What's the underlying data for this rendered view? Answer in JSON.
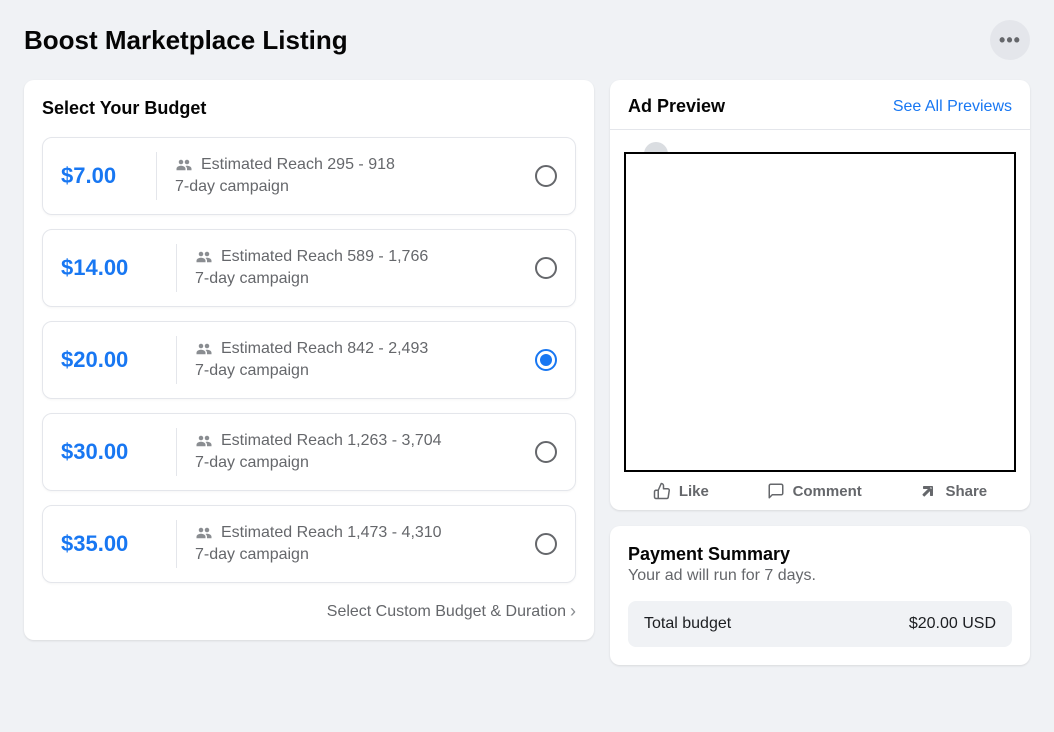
{
  "header": {
    "title": "Boost Marketplace Listing"
  },
  "budget": {
    "title": "Select Your Budget",
    "options": [
      {
        "price": "$7.00",
        "reach": "Estimated Reach 295 - 918",
        "duration": "7-day campaign",
        "selected": false
      },
      {
        "price": "$14.00",
        "reach": "Estimated Reach 589 - 1,766",
        "duration": "7-day campaign",
        "selected": false
      },
      {
        "price": "$20.00",
        "reach": "Estimated Reach 842 - 2,493",
        "duration": "7-day campaign",
        "selected": true
      },
      {
        "price": "$30.00",
        "reach": "Estimated Reach 1,263 - 3,704",
        "duration": "7-day campaign",
        "selected": false
      },
      {
        "price": "$35.00",
        "reach": "Estimated Reach 1,473 - 4,310",
        "duration": "7-day campaign",
        "selected": false
      }
    ],
    "custom_link": "Select Custom Budget & Duration"
  },
  "preview": {
    "title": "Ad Preview",
    "see_all": "See All Previews",
    "actions": {
      "like": "Like",
      "comment": "Comment",
      "share": "Share"
    }
  },
  "payment": {
    "title": "Payment Summary",
    "subtitle": "Your ad will run for 7 days.",
    "total_label": "Total budget",
    "total_value": "$20.00 USD"
  }
}
